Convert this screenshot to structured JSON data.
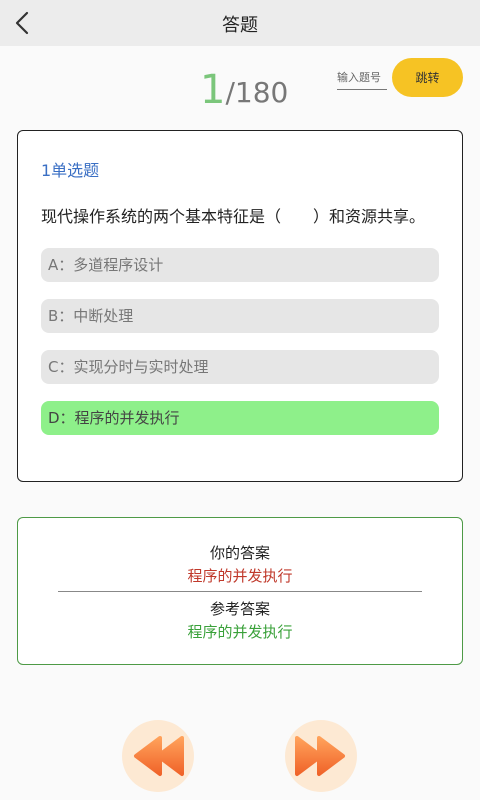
{
  "header": {
    "title": "答题"
  },
  "progress": {
    "current": "1",
    "separator": "/",
    "total": "180"
  },
  "jump": {
    "placeholder": "输入题号",
    "button_label": "跳转"
  },
  "question": {
    "type_label": "1单选题",
    "text": "现代操作系统的两个基本特征是（　　）和资源共享。",
    "options": [
      {
        "label": "A：多道程序设计",
        "state": "normal"
      },
      {
        "label": "B：中断处理",
        "state": "normal"
      },
      {
        "label": "C：实现分时与实时处理",
        "state": "normal"
      },
      {
        "label": "D：程序的并发执行",
        "state": "correct"
      }
    ]
  },
  "answer": {
    "yours_label": "你的答案",
    "yours_value": "程序的并发执行",
    "reference_label": "参考答案",
    "reference_value": "程序的并发执行"
  },
  "nav": {
    "prev_icon": "rewind-icon",
    "next_icon": "fast-forward-icon"
  },
  "colors": {
    "accent": "#f6c324",
    "correct_option": "#8ef08a",
    "your_answer": "#c0392b",
    "reference_answer": "#3aa13a",
    "progress_current": "#7bc67b"
  }
}
